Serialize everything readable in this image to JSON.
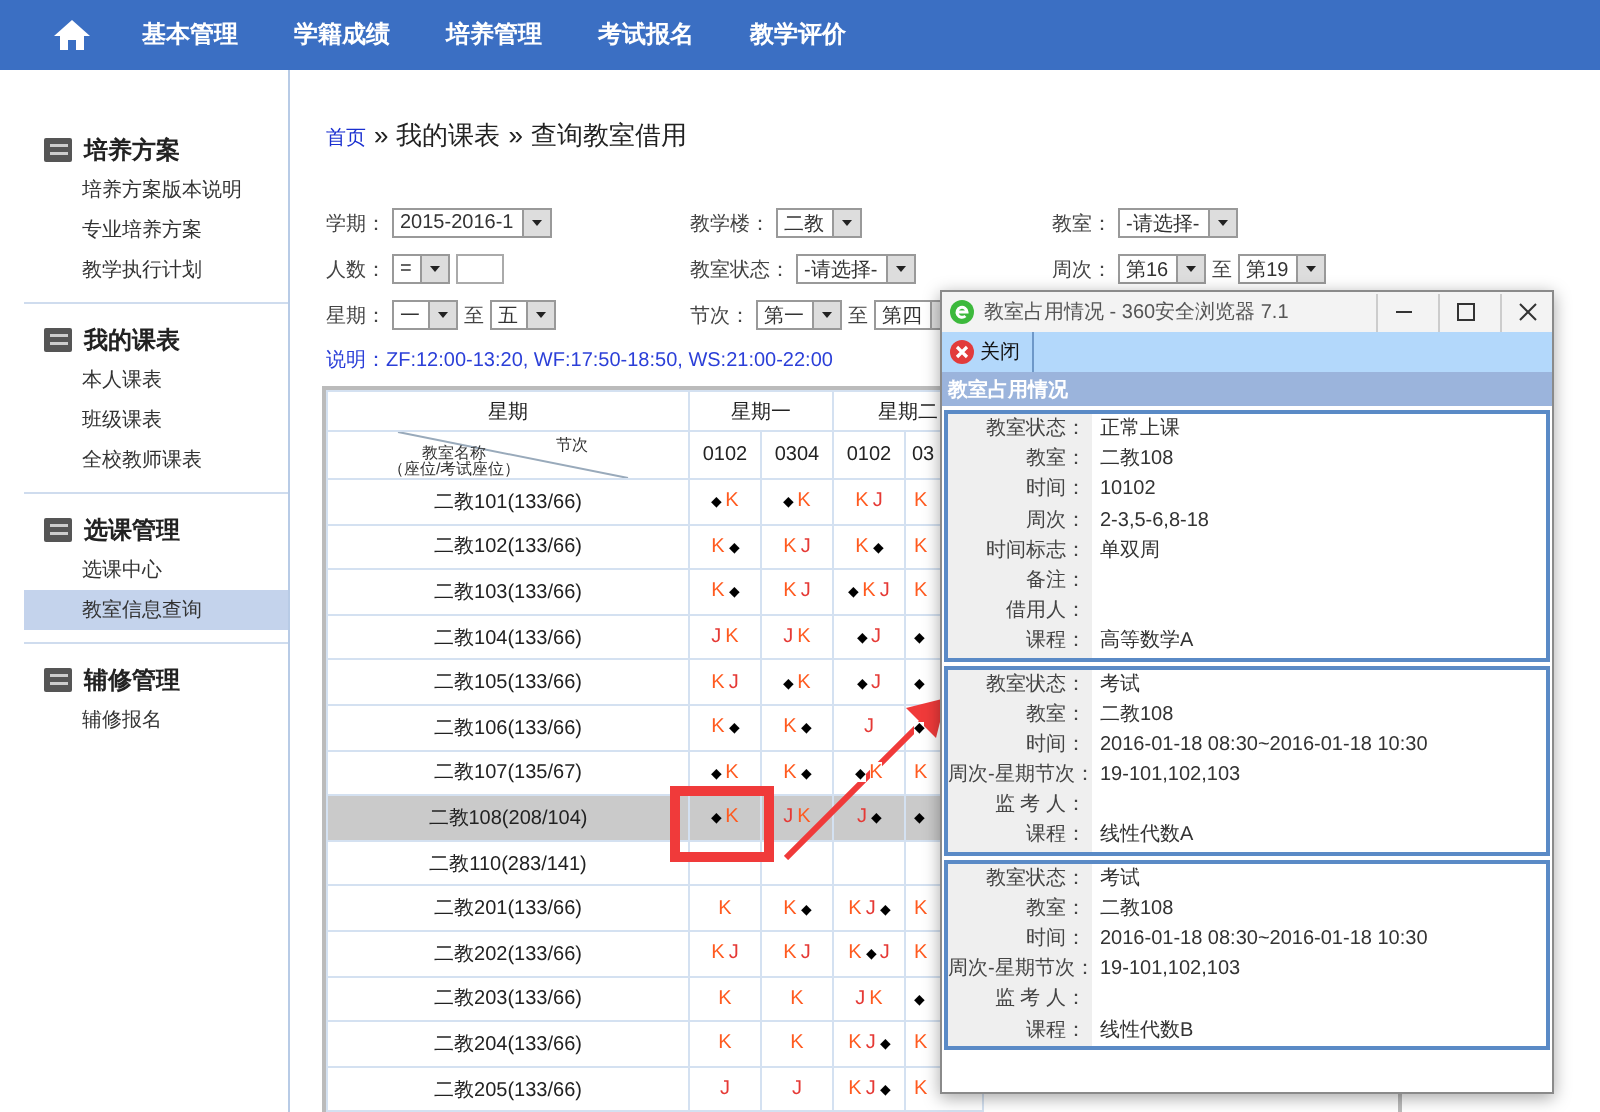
{
  "nav": {
    "items": [
      "基本管理",
      "学籍成绩",
      "培养管理",
      "考试报名",
      "教学评价"
    ]
  },
  "sidebar": {
    "groups": [
      {
        "title": "培养方案",
        "items": [
          {
            "label": "培养方案版本说明",
            "selected": false
          },
          {
            "label": "专业培养方案",
            "selected": false
          },
          {
            "label": "教学执行计划",
            "selected": false
          }
        ]
      },
      {
        "title": "我的课表",
        "items": [
          {
            "label": "本人课表",
            "selected": false
          },
          {
            "label": "班级课表",
            "selected": false
          },
          {
            "label": "全校教师课表",
            "selected": false
          }
        ]
      },
      {
        "title": "选课管理",
        "items": [
          {
            "label": "选课中心",
            "selected": false
          },
          {
            "label": "教室信息查询",
            "selected": true
          }
        ]
      },
      {
        "title": "辅修管理",
        "items": [
          {
            "label": "辅修报名",
            "selected": false
          }
        ]
      }
    ]
  },
  "breadcrumb": {
    "link": "首页",
    "separators": [
      "»",
      "»"
    ],
    "items": [
      "我的课表",
      "查询教室借用"
    ]
  },
  "filters": [
    {
      "label": "学期：",
      "controls": [
        {
          "kind": "select",
          "value": "2015-2016-1"
        }
      ]
    },
    {
      "label": "教学楼：",
      "controls": [
        {
          "kind": "select",
          "value": "二教"
        }
      ]
    },
    {
      "label": "教室：",
      "controls": [
        {
          "kind": "select",
          "value": "-请选择-"
        }
      ]
    },
    {
      "label": "人数：",
      "controls": [
        {
          "kind": "select",
          "value": "="
        },
        {
          "kind": "input"
        }
      ]
    },
    {
      "label": "教室状态：",
      "controls": [
        {
          "kind": "select",
          "value": "-请选择-"
        }
      ]
    },
    {
      "label": "周次：",
      "controls": [
        {
          "kind": "select",
          "value": "第16"
        },
        {
          "kind": "text",
          "text": "至"
        },
        {
          "kind": "select",
          "value": "第19"
        }
      ]
    },
    {
      "label": "星期：",
      "controls": [
        {
          "kind": "select",
          "value": "一"
        },
        {
          "kind": "text",
          "text": "至"
        },
        {
          "kind": "select",
          "value": "五"
        }
      ]
    },
    {
      "label": "节次：",
      "controls": [
        {
          "kind": "select",
          "value": "第一"
        },
        {
          "kind": "text",
          "text": "至"
        },
        {
          "kind": "select",
          "value": "第四"
        }
      ]
    }
  ],
  "note": "说明：ZF:12:00-13:20, WF:17:50-18:50, WS:21:00-22:00",
  "table": {
    "corner": {
      "top": "星期",
      "diag_right": "节次",
      "diag_left": "教室名称",
      "diag_left_sub": "（座位/考试座位）"
    },
    "days": [
      "星期一",
      "星期二"
    ],
    "slots": [
      "0102",
      "0304",
      "0102",
      "03"
    ],
    "rows": [
      {
        "name": "二教101(133/66)",
        "selected": false,
        "cells": [
          [
            {
              "text": "◆",
              "color": "#000000"
            },
            {
              "text": "K",
              "color": "#ff5a1f"
            }
          ],
          [
            {
              "text": "◆",
              "color": "#000000"
            },
            {
              "text": "K",
              "color": "#ff5a1f"
            }
          ],
          [
            {
              "text": "K",
              "color": "#ff5a1f"
            },
            {
              "text": "J",
              "color": "#e53935"
            }
          ],
          [
            {
              "text": "K",
              "color": "#ff5a1f"
            }
          ]
        ]
      },
      {
        "name": "二教102(133/66)",
        "selected": false,
        "cells": [
          [
            {
              "text": "K",
              "color": "#ff5a1f"
            },
            {
              "text": "◆",
              "color": "#000000"
            }
          ],
          [
            {
              "text": "K",
              "color": "#ff5a1f"
            },
            {
              "text": "J",
              "color": "#e53935"
            }
          ],
          [
            {
              "text": "K",
              "color": "#ff5a1f"
            },
            {
              "text": "◆",
              "color": "#000000"
            }
          ],
          [
            {
              "text": "K",
              "color": "#ff5a1f"
            }
          ]
        ]
      },
      {
        "name": "二教103(133/66)",
        "selected": false,
        "cells": [
          [
            {
              "text": "K",
              "color": "#ff5a1f"
            },
            {
              "text": "◆",
              "color": "#000000"
            }
          ],
          [
            {
              "text": "K",
              "color": "#ff5a1f"
            },
            {
              "text": "J",
              "color": "#e53935"
            }
          ],
          [
            {
              "text": "◆",
              "color": "#000000"
            },
            {
              "text": "K",
              "color": "#ff5a1f"
            },
            {
              "text": "J",
              "color": "#e53935"
            }
          ],
          [
            {
              "text": "K",
              "color": "#ff5a1f"
            }
          ]
        ]
      },
      {
        "name": "二教104(133/66)",
        "selected": false,
        "cells": [
          [
            {
              "text": "J",
              "color": "#e53935"
            },
            {
              "text": "K",
              "color": "#ff5a1f"
            }
          ],
          [
            {
              "text": "J",
              "color": "#e53935"
            },
            {
              "text": "K",
              "color": "#ff5a1f"
            }
          ],
          [
            {
              "text": "◆",
              "color": "#000000"
            },
            {
              "text": "J",
              "color": "#e53935"
            }
          ],
          [
            {
              "text": "◆",
              "color": "#000000"
            }
          ]
        ]
      },
      {
        "name": "二教105(133/66)",
        "selected": false,
        "cells": [
          [
            {
              "text": "K",
              "color": "#ff5a1f"
            },
            {
              "text": "J",
              "color": "#e53935"
            }
          ],
          [
            {
              "text": "◆",
              "color": "#000000"
            },
            {
              "text": "K",
              "color": "#ff5a1f"
            }
          ],
          [
            {
              "text": "◆",
              "color": "#000000"
            },
            {
              "text": "J",
              "color": "#e53935"
            }
          ],
          [
            {
              "text": "◆",
              "color": "#000000"
            }
          ]
        ]
      },
      {
        "name": "二教106(133/66)",
        "selected": false,
        "cells": [
          [
            {
              "text": "K",
              "color": "#ff5a1f"
            },
            {
              "text": "◆",
              "color": "#000000"
            }
          ],
          [
            {
              "text": "K",
              "color": "#ff5a1f"
            },
            {
              "text": "◆",
              "color": "#000000"
            }
          ],
          [
            {
              "text": "J",
              "color": "#e53935"
            }
          ],
          [
            {
              "text": "◆",
              "color": "#000000"
            }
          ]
        ]
      },
      {
        "name": "二教107(135/67)",
        "selected": false,
        "cells": [
          [
            {
              "text": "◆",
              "color": "#000000"
            },
            {
              "text": "K",
              "color": "#ff5a1f"
            }
          ],
          [
            {
              "text": "K",
              "color": "#ff5a1f"
            },
            {
              "text": "◆",
              "color": "#000000"
            }
          ],
          [
            {
              "text": "◆",
              "color": "#000000"
            },
            {
              "text": "K",
              "color": "#ff5a1f"
            }
          ],
          [
            {
              "text": "K",
              "color": "#ff5a1f"
            }
          ]
        ]
      },
      {
        "name": "二教108(208/104)",
        "selected": true,
        "cells": [
          [
            {
              "text": "◆",
              "color": "#000000"
            },
            {
              "text": "K",
              "color": "#ff5a1f"
            }
          ],
          [
            {
              "text": "J",
              "color": "#e53935"
            },
            {
              "text": "K",
              "color": "#ff5a1f"
            }
          ],
          [
            {
              "text": "J",
              "color": "#e53935"
            },
            {
              "text": "◆",
              "color": "#000000"
            }
          ],
          [
            {
              "text": "◆",
              "color": "#000000"
            }
          ]
        ]
      },
      {
        "name": "二教110(283/141)",
        "selected": false,
        "cells": [
          [],
          [],
          [],
          []
        ]
      },
      {
        "name": "二教201(133/66)",
        "selected": false,
        "cells": [
          [
            {
              "text": "K",
              "color": "#ff5a1f"
            }
          ],
          [
            {
              "text": "K",
              "color": "#ff5a1f"
            },
            {
              "text": "◆",
              "color": "#000000"
            }
          ],
          [
            {
              "text": "K",
              "color": "#ff5a1f"
            },
            {
              "text": "J",
              "color": "#e53935"
            },
            {
              "text": "◆",
              "color": "#000000"
            }
          ],
          [
            {
              "text": "K",
              "color": "#ff5a1f"
            }
          ]
        ]
      },
      {
        "name": "二教202(133/66)",
        "selected": false,
        "cells": [
          [
            {
              "text": "K",
              "color": "#ff5a1f"
            },
            {
              "text": "J",
              "color": "#e53935"
            }
          ],
          [
            {
              "text": "K",
              "color": "#ff5a1f"
            },
            {
              "text": "J",
              "color": "#e53935"
            }
          ],
          [
            {
              "text": "K",
              "color": "#ff5a1f"
            },
            {
              "text": "◆",
              "color": "#000000"
            },
            {
              "text": "J",
              "color": "#e53935"
            }
          ],
          [
            {
              "text": "K",
              "color": "#ff5a1f"
            }
          ]
        ]
      },
      {
        "name": "二教203(133/66)",
        "selected": false,
        "cells": [
          [
            {
              "text": "K",
              "color": "#ff5a1f"
            }
          ],
          [
            {
              "text": "K",
              "color": "#ff5a1f"
            }
          ],
          [
            {
              "text": "J",
              "color": "#e53935"
            },
            {
              "text": "K",
              "color": "#ff5a1f"
            }
          ],
          [
            {
              "text": "◆",
              "color": "#000000"
            }
          ]
        ]
      },
      {
        "name": "二教204(133/66)",
        "selected": false,
        "cells": [
          [
            {
              "text": "K",
              "color": "#ff5a1f"
            }
          ],
          [
            {
              "text": "K",
              "color": "#ff5a1f"
            }
          ],
          [
            {
              "text": "K",
              "color": "#ff5a1f"
            },
            {
              "text": "J",
              "color": "#e53935"
            },
            {
              "text": "◆",
              "color": "#000000"
            }
          ],
          [
            {
              "text": "K",
              "color": "#ff5a1f"
            }
          ]
        ]
      },
      {
        "name": "二教205(133/66)",
        "selected": false,
        "cells": [
          [
            {
              "text": "J",
              "color": "#e53935"
            }
          ],
          [
            {
              "text": "J",
              "color": "#e53935"
            }
          ],
          [
            {
              "text": "K",
              "color": "#ff5a1f"
            },
            {
              "text": "J",
              "color": "#e53935"
            },
            {
              "text": "◆",
              "color": "#000000"
            }
          ],
          [
            {
              "text": "K",
              "color": "#ff5a1f"
            }
          ]
        ]
      }
    ]
  },
  "popup": {
    "title": "教室占用情况 - 360安全浏览器 7.1",
    "close_button": "关闭",
    "heading": "教室占用情况",
    "records": [
      {
        "fields": [
          {
            "label": "教室状态：",
            "value": "正常上课"
          },
          {
            "label": "教室：",
            "value": "二教108"
          },
          {
            "label": "时间：",
            "value": "10102"
          },
          {
            "label": "周次：",
            "value": "2-3,5-6,8-18"
          },
          {
            "label": "时间标志：",
            "value": "单双周"
          },
          {
            "label": "备注："
          },
          {
            "label": "借用人："
          },
          {
            "label": "课程：",
            "value": "高等数学A"
          }
        ]
      },
      {
        "fields": [
          {
            "label": "教室状态：",
            "value": "考试"
          },
          {
            "label": "教室：",
            "value": "二教108"
          },
          {
            "label": "时间：",
            "value": "2016-01-18 08:30~2016-01-18 10:30"
          },
          {
            "label": "周次-星期节次：",
            "value": "19-101,102,103"
          },
          {
            "label": "监 考 人："
          },
          {
            "label": "课程：",
            "value": "线性代数A"
          }
        ]
      },
      {
        "fields": [
          {
            "label": "教室状态：",
            "value": "考试"
          },
          {
            "label": "教室：",
            "value": "二教108"
          },
          {
            "label": "时间：",
            "value": "2016-01-18 08:30~2016-01-18 10:30"
          },
          {
            "label": "周次-星期节次：",
            "value": "19-101,102,103"
          },
          {
            "label": "监 考 人："
          },
          {
            "label": "课程：",
            "value": "线性代数B"
          }
        ]
      }
    ]
  }
}
